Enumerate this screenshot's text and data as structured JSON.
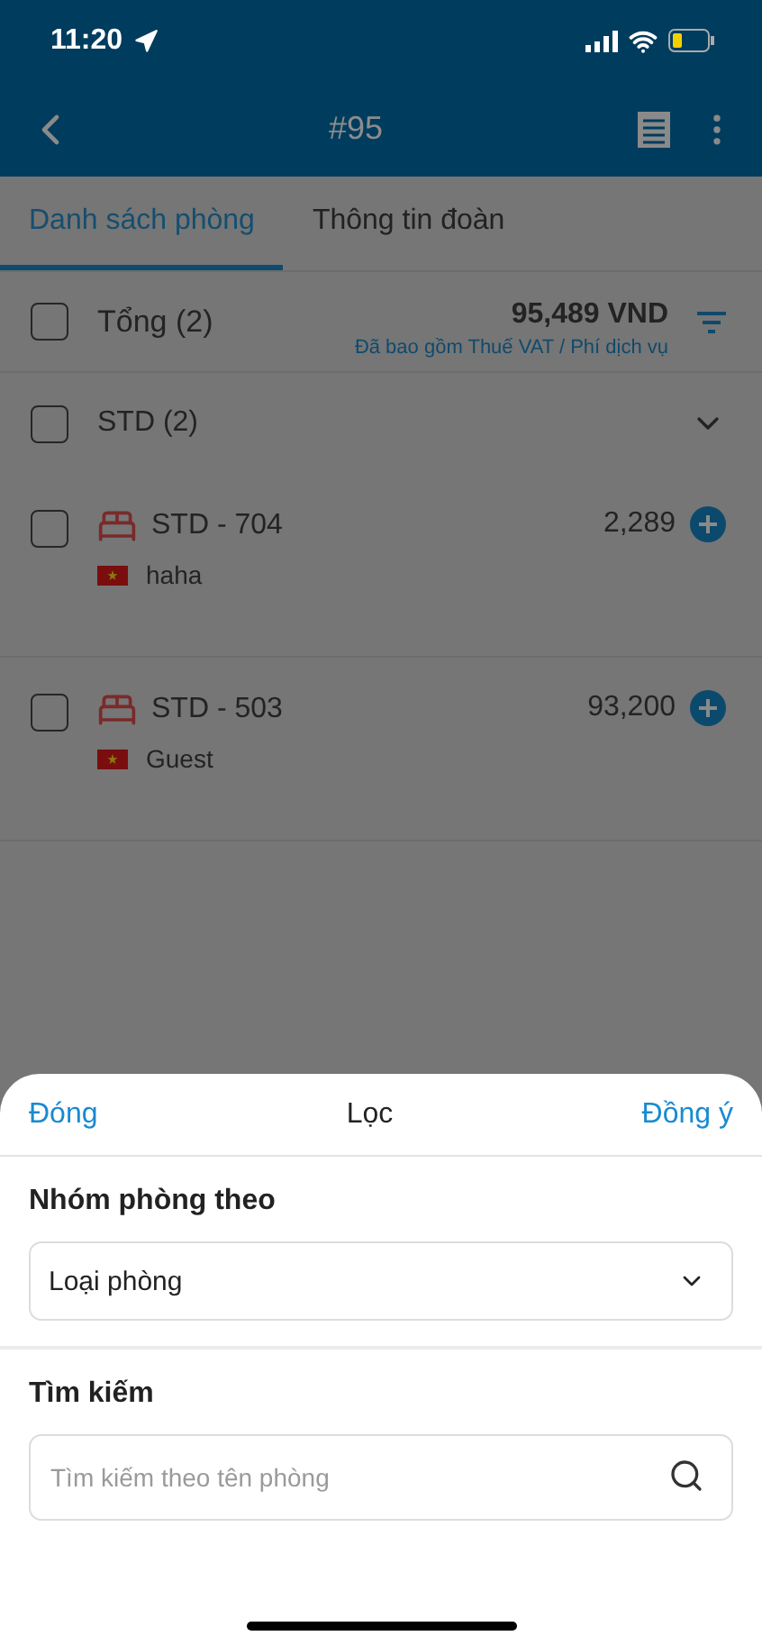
{
  "status_bar": {
    "time": "11:20"
  },
  "header": {
    "title": "#95"
  },
  "tabs": [
    {
      "label": "Danh sách phòng",
      "selected": true
    },
    {
      "label": "Thông tin đoàn",
      "selected": false
    }
  ],
  "total": {
    "label": "Tổng (2)",
    "checked": false,
    "amount": "95,489 VND",
    "note": "Đã bao gồm Thuế VAT / Phí dịch vụ"
  },
  "group": {
    "label": "STD (2)",
    "checked": false,
    "expanded": true
  },
  "rooms": [
    {
      "name": "STD - 704",
      "guest": "haha",
      "price": "2,289",
      "checked": false
    },
    {
      "name": "STD - 503",
      "guest": "Guest",
      "price": "93,200",
      "checked": false
    }
  ],
  "sheet": {
    "close": "Đóng",
    "title": "Lọc",
    "confirm": "Đồng ý",
    "group_label": "Nhóm phòng theo",
    "group_value": "Loại phòng",
    "search_label": "Tìm kiếm",
    "search_placeholder": "Tìm kiếm theo tên phòng"
  }
}
